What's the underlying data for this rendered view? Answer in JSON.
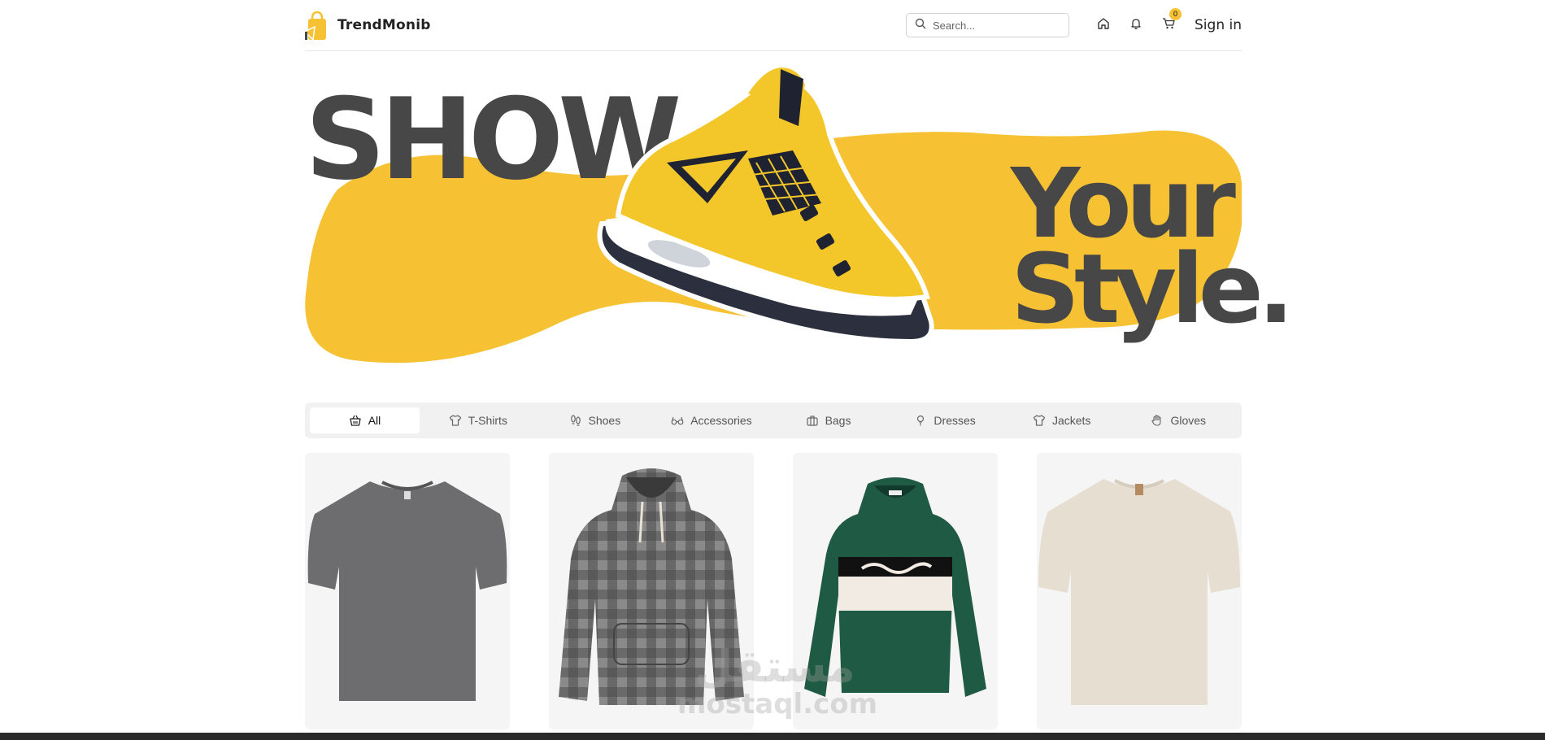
{
  "brand": {
    "name": "TrendMonib"
  },
  "header": {
    "search_placeholder": "Search...",
    "cart_count": "0",
    "signin_label": "Sign in"
  },
  "hero": {
    "word_show": "SHOW",
    "word_your": "Your",
    "word_style": "Style."
  },
  "categories": [
    {
      "label": "All",
      "icon": "basket-icon",
      "active": true
    },
    {
      "label": "T-Shirts",
      "icon": "tshirt-icon"
    },
    {
      "label": "Shoes",
      "icon": "footprints-icon"
    },
    {
      "label": "Accessories",
      "icon": "glasses-icon"
    },
    {
      "label": "Bags",
      "icon": "briefcase-icon"
    },
    {
      "label": "Dresses",
      "icon": "dress-icon"
    },
    {
      "label": "Jackets",
      "icon": "shirt-icon"
    },
    {
      "label": "Gloves",
      "icon": "hand-icon"
    }
  ],
  "products": [
    {
      "kind": "gray-tshirt"
    },
    {
      "kind": "plaid-hoodie"
    },
    {
      "kind": "green-striped-hoodie"
    },
    {
      "kind": "beige-tshirt"
    }
  ],
  "watermark": {
    "top": "مستقل",
    "bottom": "mostaql.com"
  },
  "colors": {
    "accent": "#f6c233",
    "text_dark": "#474747"
  }
}
